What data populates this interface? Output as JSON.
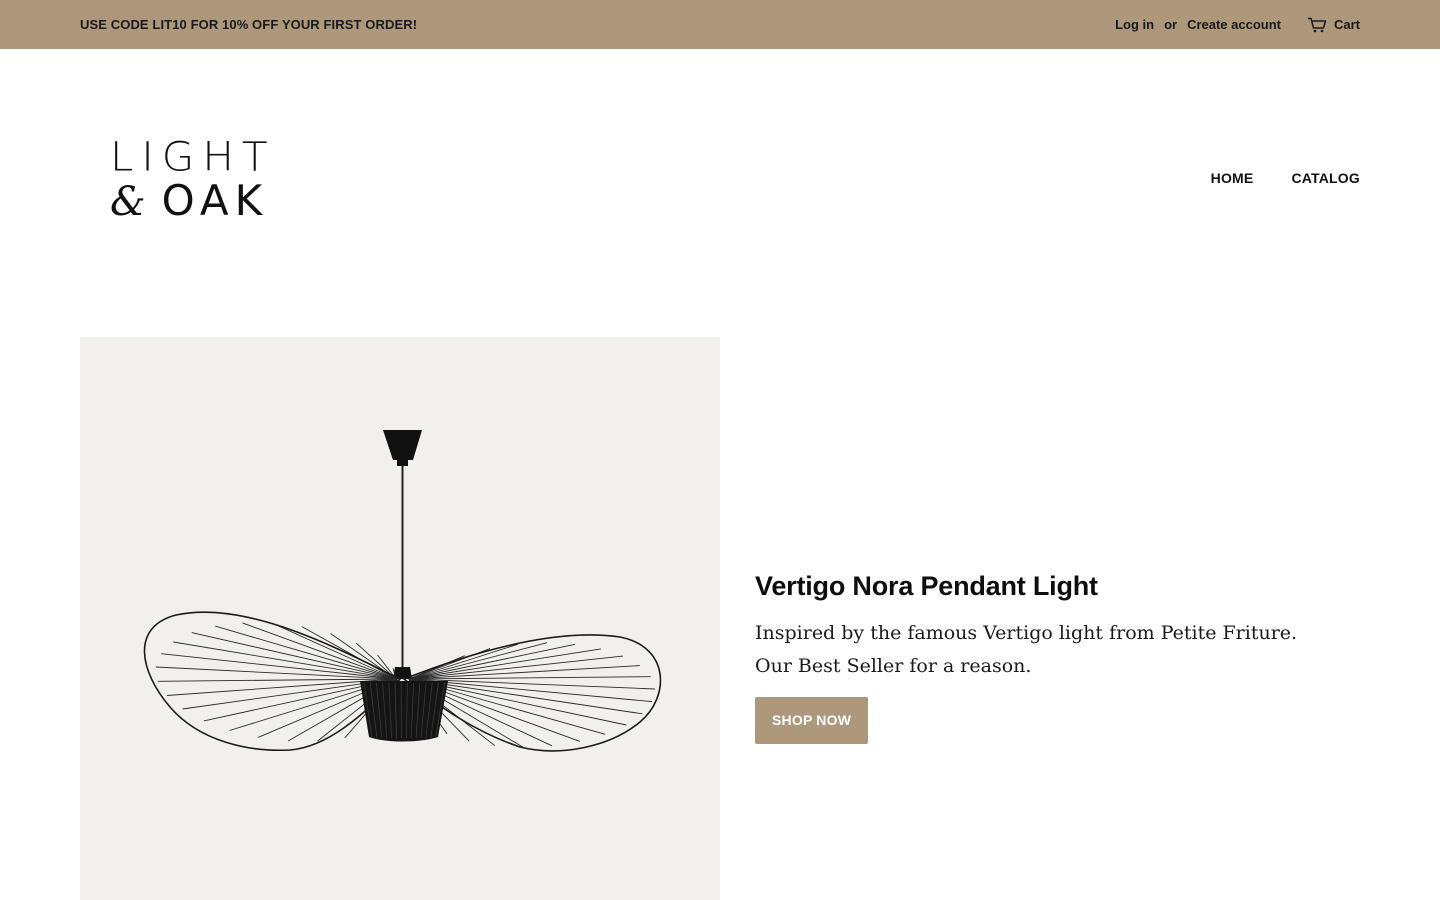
{
  "announcement": {
    "promo": "USE CODE LIT10 FOR 10% OFF YOUR FIRST ORDER!",
    "login_label": "Log in",
    "separator": "or",
    "create_account_label": "Create account",
    "cart_label": "Cart",
    "cart_icon": "cart-icon",
    "background_color": "#ad987b"
  },
  "header": {
    "logo_line1": "LIGHT",
    "logo_amp": "&",
    "logo_line2": "OAK",
    "nav": [
      {
        "label": "HOME"
      },
      {
        "label": "CATALOG"
      }
    ]
  },
  "hero": {
    "title": "Vertigo Nora Pendant Light",
    "description": "Inspired by the famous Vertigo light from Petite Friture. Our Best Seller for a reason.",
    "button_label": "SHOP NOW",
    "button_color": "#ad987b",
    "image_background": "#f2f0ed"
  }
}
